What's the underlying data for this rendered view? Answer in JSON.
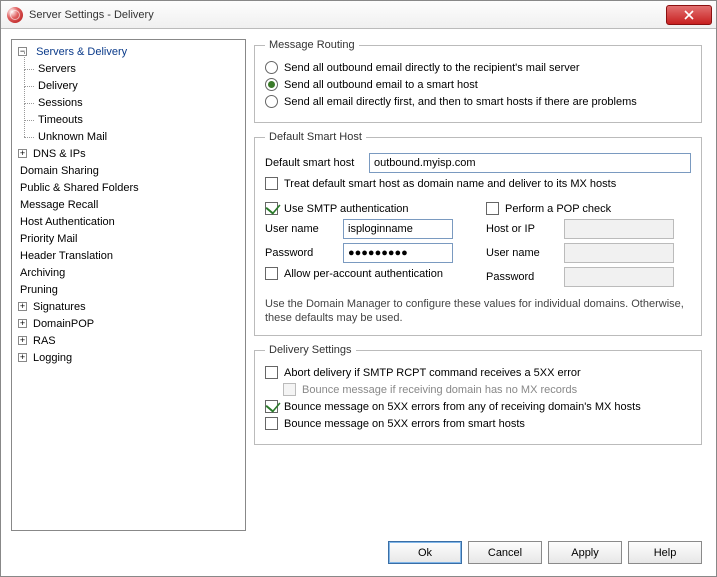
{
  "window": {
    "title": "Server Settings - Delivery"
  },
  "tree": {
    "servers_delivery": "Servers & Delivery",
    "servers": "Servers",
    "delivery": "Delivery",
    "sessions": "Sessions",
    "timeouts": "Timeouts",
    "unknown_mail": "Unknown Mail",
    "dns_ips": "DNS & IPs",
    "domain_sharing": "Domain Sharing",
    "public_shared": "Public & Shared Folders",
    "message_recall": "Message Recall",
    "host_auth": "Host Authentication",
    "priority_mail": "Priority Mail",
    "header_translation": "Header Translation",
    "archiving": "Archiving",
    "pruning": "Pruning",
    "signatures": "Signatures",
    "domainpop": "DomainPOP",
    "ras": "RAS",
    "logging": "Logging"
  },
  "routing": {
    "legend": "Message Routing",
    "opt_direct": "Send all outbound email directly to the recipient's mail server",
    "opt_smart": "Send all outbound email to a smart host",
    "opt_fallback": "Send all email directly first, and then to smart hosts if there are problems",
    "selected": "smart"
  },
  "smarthost": {
    "legend": "Default Smart Host",
    "host_label": "Default smart host",
    "host_value": "outbound.myisp.com",
    "treat_mx": "Treat default smart host as domain name and deliver to its MX hosts",
    "use_smtp_auth": "Use SMTP authentication",
    "pop_check": "Perform a POP check",
    "user_label": "User name",
    "user_value": "isploginname",
    "pass_label": "Password",
    "pass_value": "●●●●●●●●●",
    "pop_host_label": "Host or IP",
    "pop_host_value": "",
    "pop_user_label": "User name",
    "pop_user_value": "",
    "pop_pass_label": "Password",
    "pop_pass_value": "",
    "allow_per_account": "Allow per-account authentication",
    "note": "Use the Domain Manager to configure these values for individual domains. Otherwise, these defaults may be used.",
    "use_smtp_auth_checked": true,
    "pop_check_checked": false,
    "treat_mx_checked": false,
    "allow_per_account_checked": false
  },
  "delivery": {
    "legend": "Delivery Settings",
    "abort_rcpt": "Abort delivery if SMTP RCPT command receives a  5XX error",
    "bounce_no_mx": "Bounce message if receiving domain has no MX records",
    "bounce_mx_5xx": "Bounce message on 5XX errors from any of receiving domain's MX hosts",
    "bounce_smart_5xx": "Bounce message on 5XX errors from smart hosts",
    "abort_rcpt_checked": false,
    "bounce_no_mx_checked": false,
    "bounce_no_mx_disabled": true,
    "bounce_mx_5xx_checked": true,
    "bounce_smart_5xx_checked": false
  },
  "buttons": {
    "ok": "Ok",
    "cancel": "Cancel",
    "apply": "Apply",
    "help": "Help"
  }
}
